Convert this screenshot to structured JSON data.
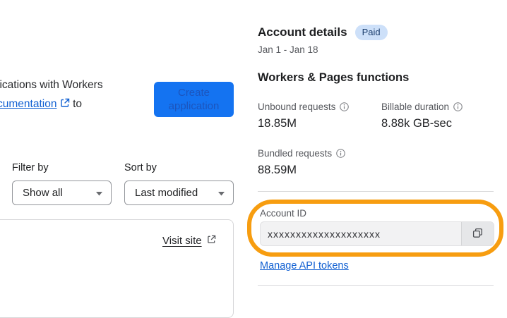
{
  "left": {
    "intro_line1": "lications with Workers",
    "intro_link_text": "cumentation",
    "intro_line2_rest": " to",
    "create_button_label": "Create application",
    "filter_label": "Filter by",
    "filter_value": "Show all",
    "sort_label": "Sort by",
    "sort_value": "Last modified",
    "visit_site_label": "Visit site"
  },
  "account": {
    "title": "Account details",
    "badge": "Paid",
    "date_range": "Jan 1 - Jan 18",
    "section_title": "Workers & Pages functions",
    "metrics": [
      {
        "label": "Unbound requests",
        "value": "18.85M"
      },
      {
        "label": "Billable duration",
        "value": "8.88k GB-sec"
      },
      {
        "label": "Bundled requests",
        "value": "88.59M"
      }
    ],
    "account_id_label": "Account ID",
    "account_id_value": "xxxxxxxxxxxxxxxxxxxx",
    "manage_link_label": "Manage API tokens"
  },
  "icons": {
    "external_link": "external-link-icon",
    "info": "info-icon",
    "copy": "copy-icon",
    "chevron_down": "chevron-down-icon"
  },
  "colors": {
    "accent_blue": "#1473f1",
    "link_blue": "#1160d2",
    "badge_bg": "#cde0f9",
    "badge_text": "#1d3f6e",
    "annotation_orange": "#f79d10",
    "input_bg": "#f2f2f3",
    "divider": "#d9d9db"
  }
}
